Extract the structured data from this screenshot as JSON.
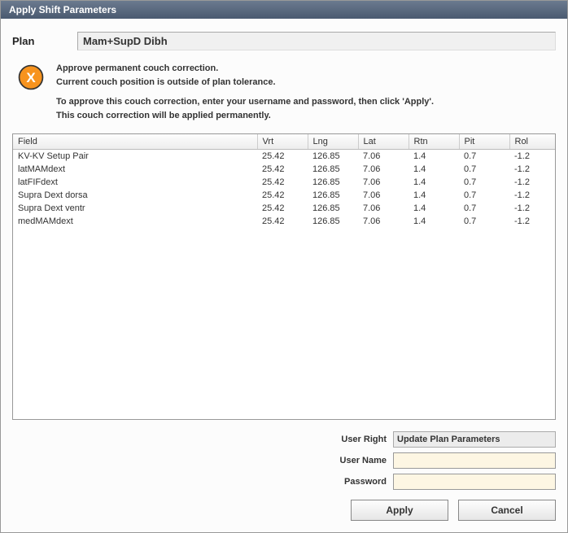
{
  "window": {
    "title": "Apply Shift Parameters"
  },
  "plan": {
    "label": "Plan",
    "value": "Mam+SupD Dibh"
  },
  "message": {
    "line1": "Approve permanent couch correction.",
    "line2": "Current couch position is outside of plan tolerance.",
    "line3": "To approve this couch correction, enter your username and password, then click 'Apply'.",
    "line4": "This couch correction will be applied permanently."
  },
  "table": {
    "headers": {
      "field": "Field",
      "vrt": "Vrt",
      "lng": "Lng",
      "lat": "Lat",
      "rtn": "Rtn",
      "pit": "Pit",
      "rol": "Rol"
    },
    "rows": [
      {
        "field": "KV-KV Setup Pair",
        "vrt": "25.42",
        "lng": "126.85",
        "lat": "7.06",
        "rtn": "1.4",
        "pit": "0.7",
        "rol": "-1.2"
      },
      {
        "field": "latMAMdext",
        "vrt": "25.42",
        "lng": "126.85",
        "lat": "7.06",
        "rtn": "1.4",
        "pit": "0.7",
        "rol": "-1.2"
      },
      {
        "field": "latFIFdext",
        "vrt": "25.42",
        "lng": "126.85",
        "lat": "7.06",
        "rtn": "1.4",
        "pit": "0.7",
        "rol": "-1.2"
      },
      {
        "field": "Supra Dext dorsa",
        "vrt": "25.42",
        "lng": "126.85",
        "lat": "7.06",
        "rtn": "1.4",
        "pit": "0.7",
        "rol": "-1.2"
      },
      {
        "field": "Supra Dext ventr",
        "vrt": "25.42",
        "lng": "126.85",
        "lat": "7.06",
        "rtn": "1.4",
        "pit": "0.7",
        "rol": "-1.2"
      },
      {
        "field": "medMAMdext",
        "vrt": "25.42",
        "lng": "126.85",
        "lat": "7.06",
        "rtn": "1.4",
        "pit": "0.7",
        "rol": "-1.2"
      }
    ]
  },
  "auth": {
    "user_right_label": "User Right",
    "user_right_value": "Update Plan Parameters",
    "username_label": "User Name",
    "username_value": "",
    "password_label": "Password",
    "password_value": ""
  },
  "buttons": {
    "apply": "Apply",
    "cancel": "Cancel"
  }
}
